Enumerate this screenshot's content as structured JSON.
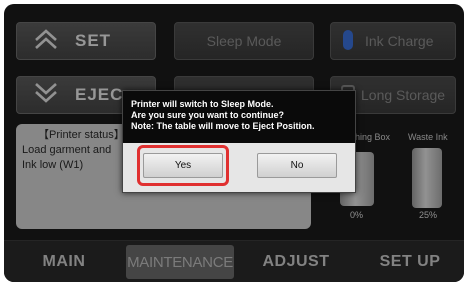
{
  "top_buttons": {
    "set_label": "SET",
    "eject_label": "EJEC",
    "sleep_mode_label": "Sleep Mode",
    "ink_charge_label": "Ink Charge",
    "long_storage_label": "Long Storage"
  },
  "status_panel": {
    "title": "【Printer status】",
    "line1": "Load garment and",
    "line2": "Ink low (W1)"
  },
  "ink_levels": {
    "left_label": "hing Box",
    "right_label": "Waste Ink",
    "left_percent": "0%",
    "right_percent": "25%"
  },
  "tabs": [
    {
      "label": "MAIN",
      "active": false
    },
    {
      "label": "MAINTENANCE",
      "active": true
    },
    {
      "label": "ADJUST",
      "active": false
    },
    {
      "label": "SET UP",
      "active": false
    }
  ],
  "dialog": {
    "line1": "Printer will switch to Sleep Mode.",
    "line2": "Are you sure you want to continue?",
    "line3": "Note: The table will move to Eject Position.",
    "yes_label": "Yes",
    "no_label": "No"
  },
  "colors": {
    "highlight": "#e03030",
    "ink_drop": "#3a6fd8"
  }
}
